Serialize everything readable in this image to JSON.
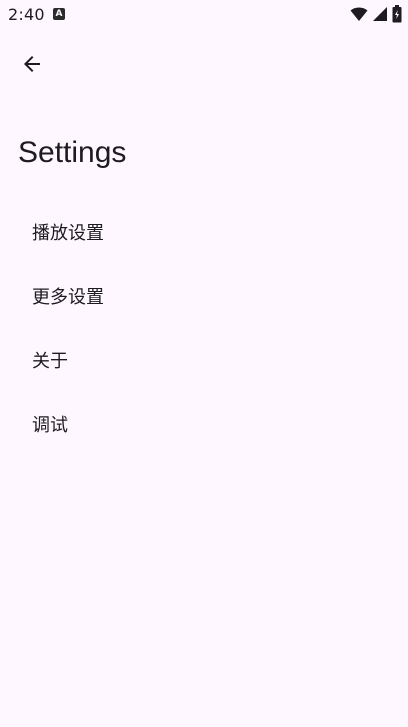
{
  "status_bar": {
    "time": "2:40",
    "notification_glyph": "A",
    "icons": [
      "wifi-icon",
      "signal-icon",
      "battery-icon"
    ]
  },
  "toolbar": {
    "back_icon": "arrow-back-icon"
  },
  "page": {
    "title": "Settings"
  },
  "preferences": [
    {
      "label": "播放设置"
    },
    {
      "label": "更多设置"
    },
    {
      "label": "关于"
    },
    {
      "label": "调试"
    }
  ],
  "colors": {
    "background": "#fef7ff",
    "text": "#1d1b20"
  }
}
